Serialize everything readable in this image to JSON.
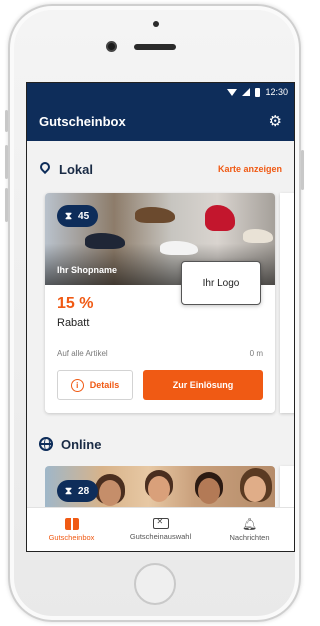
{
  "status_bar": {
    "time": "12:30"
  },
  "app_bar": {
    "title": "Gutscheinbox",
    "settings_icon": "gear-icon"
  },
  "local_section": {
    "title": "Lokal",
    "icon": "location-pin-icon",
    "link": "Karte anzeigen"
  },
  "local_card": {
    "timer_count": "45",
    "shop_name": "Ihr Shopname",
    "logo_text": "Ihr Logo",
    "discount": "15 %",
    "discount_label": "Rabatt",
    "scope": "Auf alle Artikel",
    "distance": "0 m",
    "details_button": "Details",
    "redeem_button": "Zur Einlösung"
  },
  "online_section": {
    "title": "Online",
    "icon": "globe-icon"
  },
  "online_card": {
    "timer_count": "28"
  },
  "bottom_nav": [
    {
      "label": "Gutscheinbox",
      "icon": "gift-icon",
      "active": true
    },
    {
      "label": "Gutscheinauswahl",
      "icon": "ticket-icon",
      "active": false
    },
    {
      "label": "Nachrichten",
      "icon": "bell-icon",
      "active": false
    }
  ],
  "colors": {
    "primary": "#0e2d5a",
    "accent": "#f05a14",
    "background": "#f2f2f2"
  }
}
